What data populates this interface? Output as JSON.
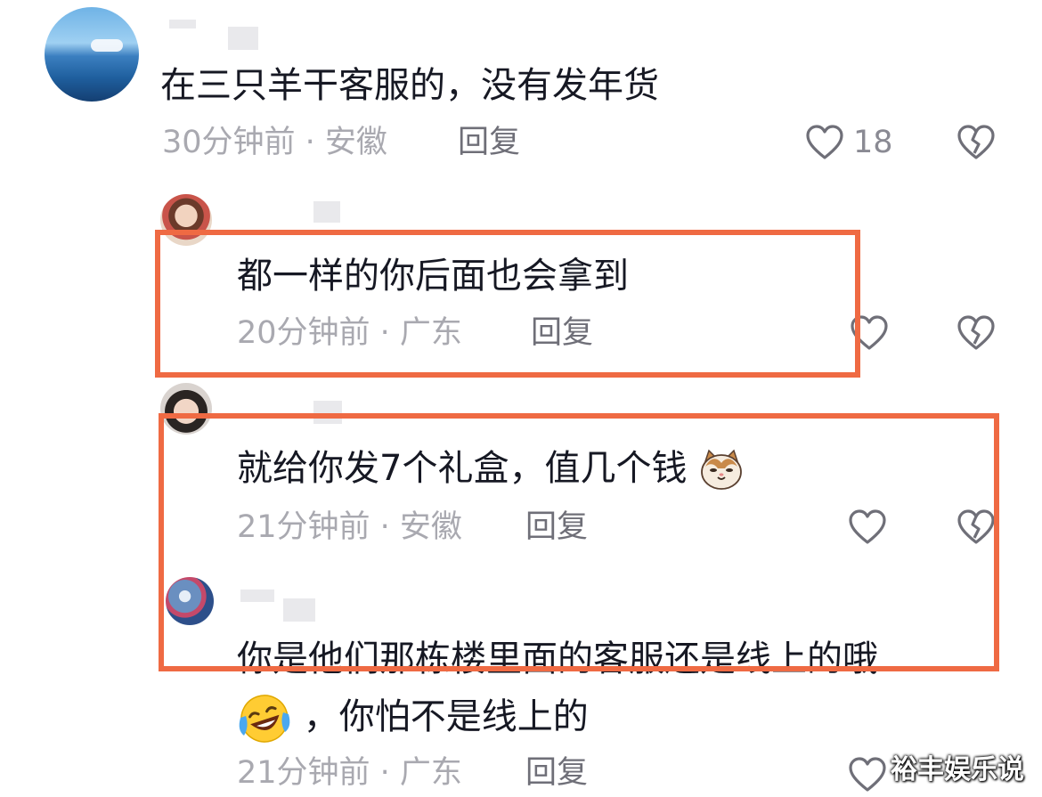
{
  "comments": [
    {
      "text": "在三只羊干客服的，没有发年货",
      "time_location": "30分钟前 · 安徽",
      "reply_label": "回复",
      "likes": "18",
      "avatar_icon": "sea-avatar"
    },
    {
      "text": "都一样的你后面也会拿到",
      "time_location": "20分钟前 · 广东",
      "reply_label": "回复",
      "avatar_icon": "girl-avatar"
    },
    {
      "text": "就给你发7个礼盒，值几个钱",
      "text_emoji": "cat-emoji",
      "time_location": "21分钟前 · 安徽",
      "reply_label": "回复",
      "avatar_icon": "kid-avatar"
    },
    {
      "text_line1": "你是他们那栋楼里面的客服还是线上的哦",
      "text_line2": "，你怕不是线上的",
      "text_emoji": "laughing-crying-emoji",
      "time_location": "21分钟前 · 广东",
      "reply_label": "回复",
      "avatar_icon": "art-avatar"
    }
  ],
  "watermark": "裕丰娱乐说",
  "colors": {
    "highlight_box": "#ef6a43",
    "meta_text": "#a9a9b0",
    "reply_text": "#6f6f78"
  }
}
